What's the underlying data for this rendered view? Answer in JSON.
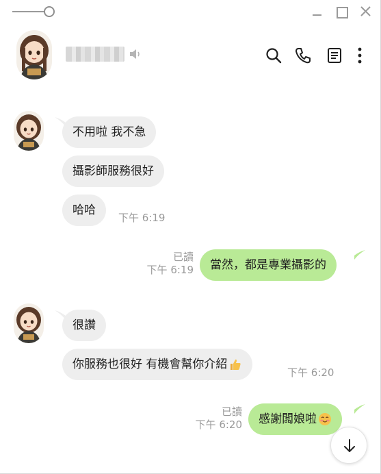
{
  "window": {
    "controls": {
      "minimize": "minimize",
      "maximize": "maximize",
      "close": "close"
    }
  },
  "header": {
    "contact_name": "████████",
    "icons": [
      "search-icon",
      "phone-icon",
      "notes-icon",
      "more-icon"
    ]
  },
  "messages": [
    {
      "direction": "in",
      "text": "不用啦 我不急"
    },
    {
      "direction": "in",
      "text": "攝影師服務很好"
    },
    {
      "direction": "in",
      "text": "哈哈",
      "time": "下午 6:19"
    },
    {
      "direction": "out",
      "text": "當然，都是專業攝影的",
      "read": "已讀",
      "time": "下午 6:19"
    },
    {
      "direction": "in",
      "text": "很讚"
    },
    {
      "direction": "in",
      "text": "你服務也很好 有機會幫你介紹",
      "emoji": "thumbs-up-icon",
      "time": "下午 6:20"
    },
    {
      "direction": "out",
      "text": "感謝闆娘啦",
      "emoji": "smiling-face-icon",
      "read": "已讀",
      "time": "下午 6:20"
    }
  ],
  "colors": {
    "incoming_bubble": "#eeeeee",
    "outgoing_bubble": "#b9ea96",
    "meta_text": "#9a9a9a"
  }
}
